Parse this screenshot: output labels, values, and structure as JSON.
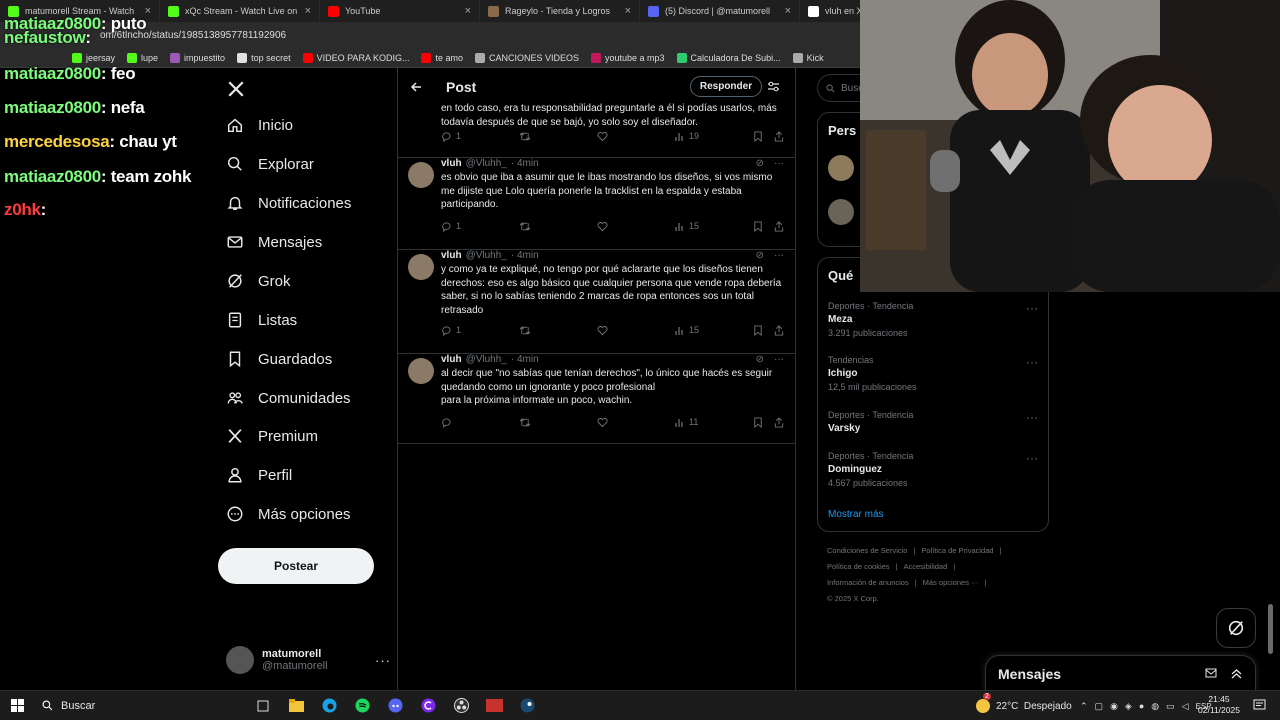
{
  "browser": {
    "tabs": [
      {
        "title": "matumorell Stream - Watch",
        "color": "#53fc18"
      },
      {
        "title": "xQc Stream - Watch Live on Kick",
        "color": "#53fc18"
      },
      {
        "title": "YouTube",
        "color": "#ff0000"
      },
      {
        "title": "Rageylo - Tienda y Logros",
        "color": "#8a6a4a"
      },
      {
        "title": "(5) Discord | @matumorell",
        "color": "#5865f2"
      },
      {
        "title": "vluh en X",
        "color": "#ffffff"
      }
    ],
    "url": "https://x.com/6tlncho/status/1985138957781192906",
    "url_visible": "om/6tlncho/status/1985138957781192906",
    "bookmarks": [
      "jeersay",
      "lupe",
      "impuestito",
      "top secret",
      "VIDEO PARA KODIG...",
      "te amo",
      "CANCIONES VIDEOS",
      "youtube a mp3",
      "Calculadora De Subi...",
      "Kick"
    ]
  },
  "chat": [
    {
      "user": "matiaaz0800",
      "msg": "puto",
      "color": "#7cfc7c"
    },
    {
      "user": "nefaustow",
      "msg": "",
      "color": "#7cfc7c"
    },
    {
      "user": "matiaaz0800",
      "msg": "feo",
      "color": "#7cfc7c"
    },
    {
      "user": "matiaaz0800",
      "msg": "nefa",
      "color": "#7cfc7c"
    },
    {
      "user": "mercedesosa",
      "msg": "chau yt",
      "color": "#ffd23f"
    },
    {
      "user": "matiaaz0800",
      "msg": "team zohk",
      "color": "#7cfc7c"
    },
    {
      "user": "z0hk",
      "msg": "",
      "color": "#ff3b3b"
    }
  ],
  "nav": {
    "items": [
      {
        "label": "Inicio",
        "icon": "home-icon"
      },
      {
        "label": "Explorar",
        "icon": "search-icon"
      },
      {
        "label": "Notificaciones",
        "icon": "bell-icon"
      },
      {
        "label": "Mensajes",
        "icon": "mail-icon"
      },
      {
        "label": "Grok",
        "icon": "grok-icon"
      },
      {
        "label": "Listas",
        "icon": "list-icon"
      },
      {
        "label": "Guardados",
        "icon": "bookmark-icon"
      },
      {
        "label": "Comunidades",
        "icon": "communities-icon"
      },
      {
        "label": "Premium",
        "icon": "x-logo-icon"
      },
      {
        "label": "Perfil",
        "icon": "person-icon"
      },
      {
        "label": "Más opciones",
        "icon": "more-circle-icon"
      }
    ],
    "post_button": "Postear",
    "account": {
      "name": "matumorell",
      "handle": "@matumorell"
    }
  },
  "post_header": {
    "title": "Post",
    "reply_button": "Responder"
  },
  "tweets": [
    {
      "name": "",
      "handle": "",
      "time": "",
      "text": "en todo caso, era tu responsabilidad preguntarle a él si podías usarlos, más todavía después de que se bajó, yo solo soy el diseñador.",
      "replies": "1",
      "retweets": "",
      "likes": "",
      "views": "19"
    },
    {
      "name": "vluh",
      "handle": "@Vluhh_",
      "time": "· 4min",
      "text": "es obvio que iba a asumir que le ibas mostrando los diseños, si vos mismo me dijiste que Lolo quería ponerle la tracklist en la espalda y estaba participando.",
      "replies": "1",
      "retweets": "",
      "likes": "",
      "views": "15"
    },
    {
      "name": "vluh",
      "handle": "@Vluhh_",
      "time": "· 4min",
      "text": "y como ya te expliqué, no tengo por qué aclararte que los diseños tienen derechos: eso es algo básico que cualquier persona que vende ropa debería saber, si no lo sabías teniendo 2 marcas de ropa entonces sos un total retrasado",
      "replies": "1",
      "retweets": "",
      "likes": "",
      "views": "15"
    },
    {
      "name": "vluh",
      "handle": "@Vluhh_",
      "time": "· 4min",
      "text": "al decir que \"no sabías que tenían derechos\", lo único que hacés es seguir quedando como un ignorante y poco profesional\npara la próxima informate un poco, wachin.",
      "replies": "",
      "retweets": "",
      "likes": "",
      "views": "11"
    }
  ],
  "right": {
    "search_placeholder": "Buscar",
    "who_title": "Pers",
    "trends_title": "Qué",
    "trends": [
      {
        "category": "Deportes · Tendencia",
        "title": "Meza",
        "posts": "3.291 publicaciones"
      },
      {
        "category": "Tendencias",
        "title": "Ichigo",
        "posts": "12,5 mil publicaciones"
      },
      {
        "category": "Deportes · Tendencia",
        "title": "Varsky",
        "posts": ""
      },
      {
        "category": "Deportes · Tendencia",
        "title": "Dominguez",
        "posts": "4.567 publicaciones"
      }
    ],
    "show_more": "Mostrar más",
    "footer_links": [
      [
        "Condiciones de Servicio",
        "Política de Privacidad"
      ],
      [
        "Política de cookies",
        "Accesibilidad"
      ],
      [
        "Información de anuncios",
        "Más opciones ···"
      ],
      [
        "© 2025 X Corp."
      ]
    ]
  },
  "messages_bar": {
    "label": "Mensajes"
  },
  "taskbar": {
    "search_placeholder": "Buscar",
    "weather": "22°C  Despejado",
    "weather_badge": "2",
    "lang": "ESP",
    "time": "21:45",
    "date": "02/11/2025"
  },
  "colors": {
    "x_accent": "#1d9bf0",
    "bg": "#000000",
    "border": "#2f3336",
    "muted": "#71767b"
  }
}
